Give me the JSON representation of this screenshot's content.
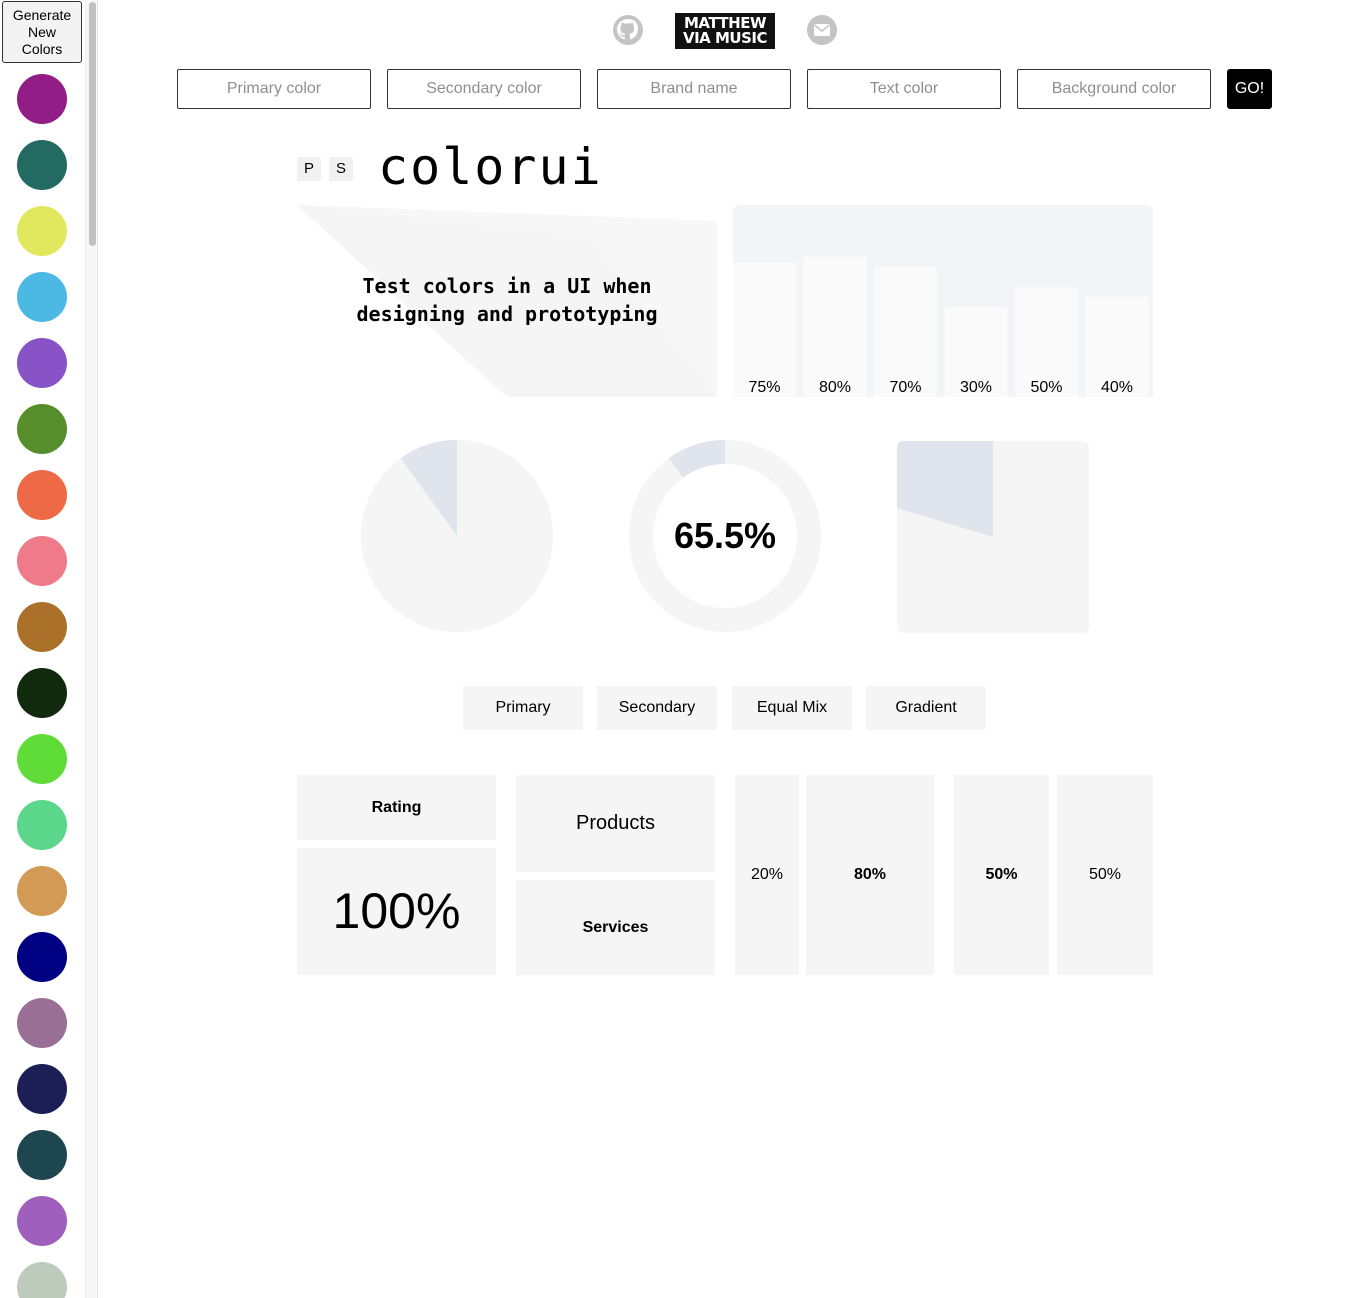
{
  "sidebar": {
    "generate_label": "Generate New Colors",
    "swatches": [
      "#931d87",
      "#236b62",
      "#e1e85e",
      "#4cb8e4",
      "#8753c7",
      "#568e2b",
      "#ee6945",
      "#ef7a8a",
      "#ab702a",
      "#11290d",
      "#5fdc37",
      "#5cd68b",
      "#d39a55",
      "#000082",
      "#9a6f95",
      "#1c1f56",
      "#1d4650",
      "#9f5fbd",
      "#bdcbbd"
    ]
  },
  "header": {
    "github_icon": "github-icon",
    "logo_text": "MATTHEW VIA MUSIC",
    "mail_icon": "mail-icon",
    "inputs": {
      "primary": "Primary color",
      "secondary": "Secondary color",
      "brand": "Brand name",
      "text": "Text color",
      "background": "Background color"
    },
    "go_label": "GO!"
  },
  "brand": {
    "badge_p": "P",
    "badge_s": "S",
    "name": "colorui"
  },
  "hero": {
    "tagline": "Test colors in a UI when designing and prototyping"
  },
  "colors": {
    "light": "#f5f5f5",
    "panel": "#f3f4f6",
    "accent": "#e0e4ec",
    "text": "#000000"
  },
  "chart_data": [
    {
      "type": "bar",
      "categories": [
        "75%",
        "80%",
        "70%",
        "30%",
        "50%",
        "40%"
      ],
      "values": [
        75,
        80,
        70,
        30,
        50,
        40
      ],
      "ylim": [
        0,
        100
      ],
      "title": "",
      "xlabel": "",
      "ylabel": ""
    },
    {
      "type": "pie",
      "values": [
        10,
        90
      ],
      "title": ""
    },
    {
      "type": "pie",
      "values": [
        10,
        90
      ],
      "title": ""
    },
    {
      "type": "area",
      "values": [
        65,
        50
      ],
      "ylim": [
        0,
        100
      ],
      "title": ""
    }
  ],
  "donut": {
    "value_label": "65.5%"
  },
  "modes": {
    "primary": "Primary",
    "secondary": "Secondary",
    "equal_mix": "Equal Mix",
    "gradient": "Gradient"
  },
  "cards": {
    "rating_title": "Rating",
    "rating_value": "100%",
    "products": "Products",
    "services": "Services",
    "split_a_small": "20%",
    "split_a_large": "80%",
    "split_b_left": "50%",
    "split_b_right": "50%"
  }
}
